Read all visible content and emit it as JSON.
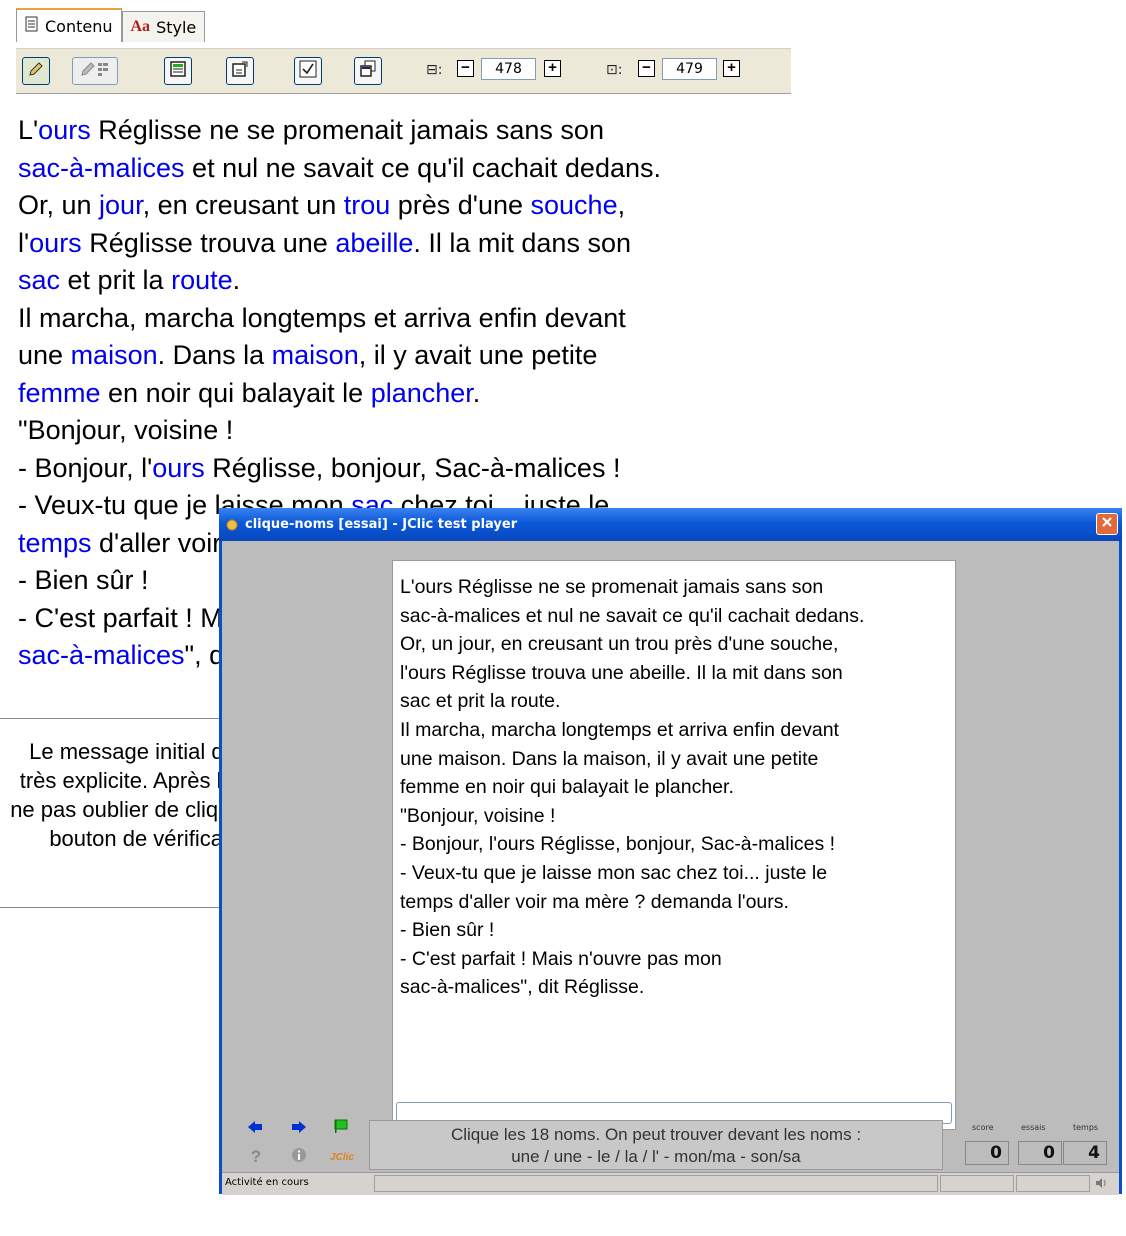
{
  "editor": {
    "tabs": [
      {
        "label": "Contenu"
      },
      {
        "label": "Style",
        "prefix": "Aa"
      }
    ],
    "width_value": "478",
    "height_value": "479",
    "lines": [
      [
        {
          "t": "L'"
        },
        {
          "t": "ours",
          "k": 1
        },
        {
          "t": " Réglisse ne se promenait jamais sans son"
        }
      ],
      [
        {
          "t": "sac-à-malices",
          "k": 1
        },
        {
          "t": " et nul ne savait ce qu'il cachait dedans."
        }
      ],
      [
        {
          "t": "Or, un "
        },
        {
          "t": "jour",
          "k": 1
        },
        {
          "t": ", en creusant un "
        },
        {
          "t": "trou",
          "k": 1
        },
        {
          "t": " près d'une "
        },
        {
          "t": "souche",
          "k": 1
        },
        {
          "t": ","
        }
      ],
      [
        {
          "t": "l'"
        },
        {
          "t": "ours",
          "k": 1
        },
        {
          "t": " Réglisse trouva une "
        },
        {
          "t": "abeille",
          "k": 1
        },
        {
          "t": ". Il la mit dans son"
        }
      ],
      [
        {
          "t": "sac",
          "k": 1
        },
        {
          "t": " et prit la "
        },
        {
          "t": "route",
          "k": 1
        },
        {
          "t": "."
        }
      ],
      [
        {
          "t": "Il marcha, marcha longtemps et arriva enfin devant"
        }
      ],
      [
        {
          "t": "une "
        },
        {
          "t": "maison",
          "k": 1
        },
        {
          "t": ". Dans la "
        },
        {
          "t": "maison",
          "k": 1
        },
        {
          "t": ", il y avait une petite"
        }
      ],
      [
        {
          "t": "femme",
          "k": 1
        },
        {
          "t": " en noir qui balayait le "
        },
        {
          "t": "plancher",
          "k": 1
        },
        {
          "t": "."
        }
      ],
      [
        {
          "t": "\"Bonjour, voisine !"
        }
      ],
      [
        {
          "t": "- Bonjour, l'"
        },
        {
          "t": "ours",
          "k": 1
        },
        {
          "t": " Réglisse, bonjour, Sac-à-malices !"
        }
      ],
      [
        {
          "t": "- Veux-tu que je laisse mon "
        },
        {
          "t": "sac",
          "k": 1
        },
        {
          "t": " chez toi... juste le"
        }
      ],
      [
        {
          "t": "temps",
          "k": 1
        },
        {
          "t": " d'aller voir ma mère ? demanda l'"
        },
        {
          "t": "ours",
          "k": 1
        },
        {
          "t": "."
        }
      ],
      [
        {
          "t": "- Bien sûr !"
        }
      ],
      [
        {
          "t": "- C'est parfait ! Mais n'ouvre pas mon"
        }
      ],
      [
        {
          "t": "sac-à-malices",
          "k": 1
        },
        {
          "t": "\", dit Réglisse."
        }
      ]
    ]
  },
  "note": {
    "text": "Le message initial doit être très explicite. Après l'activité, ne pas oublier de cliquer sur le bouton de vérification !"
  },
  "player": {
    "title": "clique-noms [essai] - JClic test player",
    "lines": [
      "L'ours Réglisse ne se promenait jamais sans son",
      "sac-à-malices et nul ne savait ce qu'il cachait dedans.",
      "Or, un jour, en creusant un trou près d'une souche,",
      "l'ours Réglisse trouva une abeille. Il la mit dans son",
      "sac et prit la route.",
      "Il marcha, marcha longtemps et arriva enfin devant",
      "une maison. Dans la maison, il y avait une petite",
      "femme en noir qui balayait le plancher.",
      "\"Bonjour, voisine !",
      "- Bonjour, l'ours Réglisse, bonjour, Sac-à-malices !",
      "- Veux-tu que je laisse mon sac chez toi... juste le",
      "temps d'aller voir ma mère ? demanda l'ours.",
      "- Bien sûr !",
      "- C'est parfait ! Mais n'ouvre pas mon",
      "sac-à-malices\", dit Réglisse."
    ],
    "message_line1": "Clique les 18 noms. On peut trouver devant les noms :",
    "message_line2": "une / une - le / la / l' - mon/ma - son/sa",
    "counters": {
      "score_label": "score",
      "score": "0",
      "essais_label": "essais",
      "essais": "0",
      "temps_label": "temps",
      "temps": "4"
    },
    "jclic_logo": "JClic",
    "status": "Activité en cours",
    "colors": {
      "title_bar": "#0b58d8",
      "keyword": "#0000ee",
      "close": "#e06a3c"
    }
  }
}
